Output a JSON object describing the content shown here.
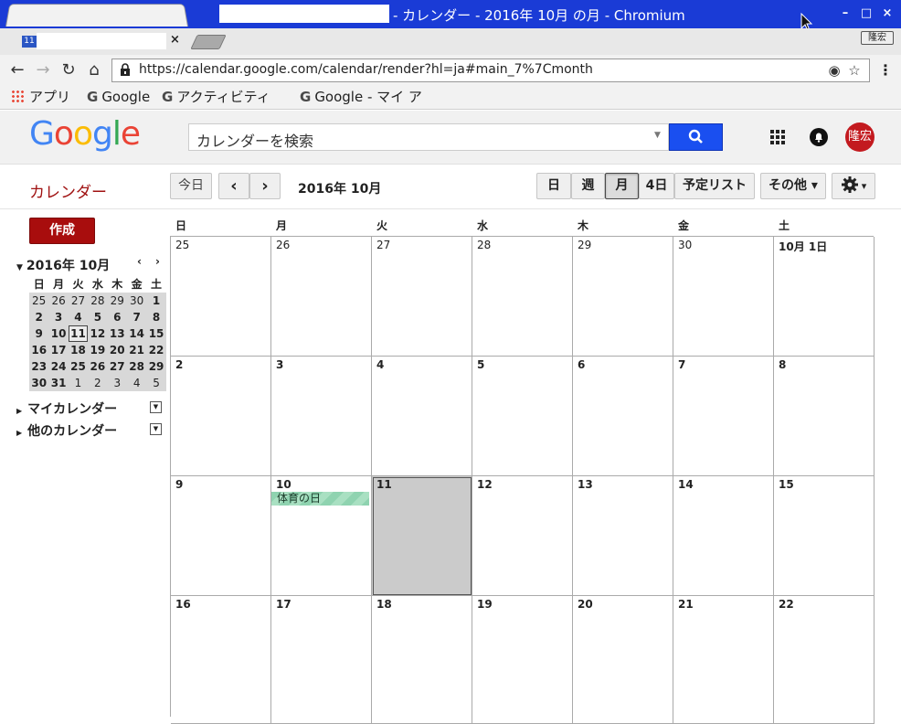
{
  "window": {
    "title": "- カレンダー - 2016年 10月 の月 - Chromium",
    "controls": {
      "minimize": "–",
      "maximize": "□",
      "close": "×"
    }
  },
  "tabs": {
    "active": {
      "favicon_text": "11",
      "close": "×"
    },
    "profile_label": "隆宏"
  },
  "browser": {
    "url": "https://calendar.google.com/calendar/render?hl=ja#main_7%7Cmonth",
    "bookmarks": [
      {
        "label": "アプリ",
        "icon": "apps-grid-icon"
      },
      {
        "label": "Google",
        "icon": "google-g-icon"
      },
      {
        "label": "アクティビティ",
        "icon": "google-g-icon"
      },
      {
        "label": "Google - マイ ア",
        "icon": "google-g-icon"
      }
    ]
  },
  "header": {
    "logo": [
      "G",
      "o",
      "o",
      "g",
      "l",
      "e"
    ],
    "logo_colors": [
      "#4285f4",
      "#ea4335",
      "#fbbc05",
      "#4285f4",
      "#34a853",
      "#ea4335"
    ],
    "search_placeholder": "カレンダーを検索",
    "avatar_label": "隆宏"
  },
  "toolbar": {
    "app_title": "カレンダー",
    "today": "今日",
    "prev": "‹",
    "next": "›",
    "date_title": "2016年 10月",
    "views": [
      "日",
      "週",
      "月",
      "4日",
      "予定リスト"
    ],
    "active_view": "月",
    "more": "その他 ▾",
    "settings_caret": "▾"
  },
  "sidebar": {
    "create": "作成",
    "mini_title": "2016年 10月",
    "mini_prev": "‹",
    "mini_next": "›",
    "mini_dow": [
      "日",
      "月",
      "火",
      "水",
      "木",
      "金",
      "土"
    ],
    "mini_weeks": [
      [
        "25",
        "26",
        "27",
        "28",
        "29",
        "30",
        "1"
      ],
      [
        "2",
        "3",
        "4",
        "5",
        "6",
        "7",
        "8"
      ],
      [
        "9",
        "10",
        "11",
        "12",
        "13",
        "14",
        "15"
      ],
      [
        "16",
        "17",
        "18",
        "19",
        "20",
        "21",
        "22"
      ],
      [
        "23",
        "24",
        "25",
        "26",
        "27",
        "28",
        "29"
      ],
      [
        "30",
        "31",
        "1",
        "2",
        "3",
        "4",
        "5"
      ]
    ],
    "my_calendars": "マイカレンダー",
    "other_calendars": "他のカレンダー"
  },
  "month": {
    "dow": [
      "日",
      "月",
      "火",
      "水",
      "木",
      "金",
      "土"
    ],
    "weeks": [
      [
        "25",
        "26",
        "27",
        "28",
        "29",
        "30",
        "10月 1日"
      ],
      [
        "2",
        "3",
        "4",
        "5",
        "6",
        "7",
        "8"
      ],
      [
        "9",
        "10",
        "11",
        "12",
        "13",
        "14",
        "15"
      ],
      [
        "16",
        "17",
        "18",
        "19",
        "20",
        "21",
        "22"
      ]
    ],
    "today": "11",
    "event": {
      "label": "体育の日",
      "day": "10"
    }
  }
}
